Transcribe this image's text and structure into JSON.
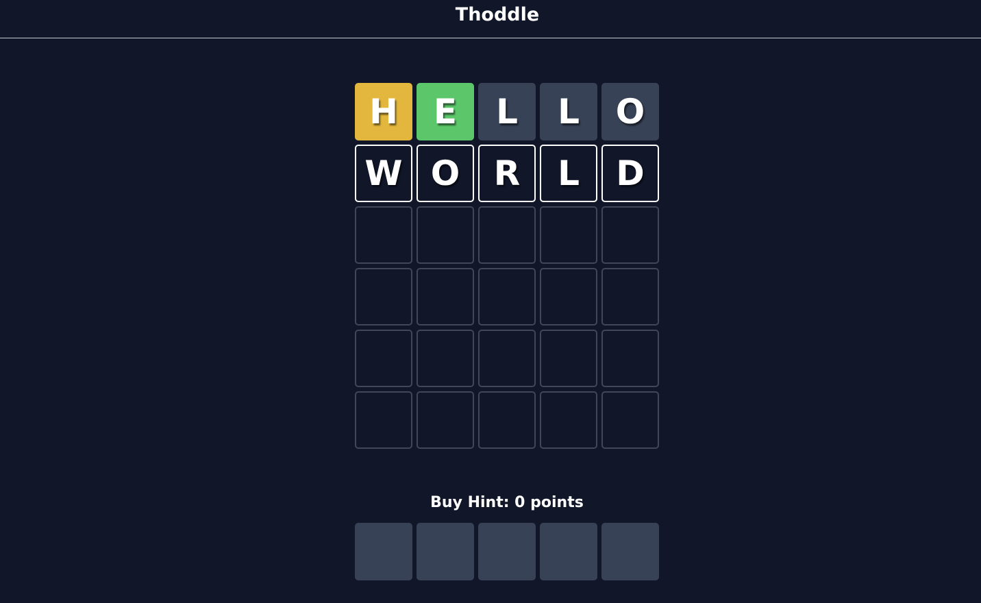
{
  "header": {
    "title": "Thoddle"
  },
  "board": {
    "rows": [
      [
        {
          "letter": "H",
          "state": "present"
        },
        {
          "letter": "E",
          "state": "correct"
        },
        {
          "letter": "L",
          "state": "absent"
        },
        {
          "letter": "L",
          "state": "absent"
        },
        {
          "letter": "O",
          "state": "absent"
        }
      ],
      [
        {
          "letter": "W",
          "state": "typed"
        },
        {
          "letter": "O",
          "state": "typed"
        },
        {
          "letter": "R",
          "state": "typed"
        },
        {
          "letter": "L",
          "state": "typed"
        },
        {
          "letter": "D",
          "state": "typed"
        }
      ],
      [
        {
          "letter": "",
          "state": "empty"
        },
        {
          "letter": "",
          "state": "empty"
        },
        {
          "letter": "",
          "state": "empty"
        },
        {
          "letter": "",
          "state": "empty"
        },
        {
          "letter": "",
          "state": "empty"
        }
      ],
      [
        {
          "letter": "",
          "state": "empty"
        },
        {
          "letter": "",
          "state": "empty"
        },
        {
          "letter": "",
          "state": "empty"
        },
        {
          "letter": "",
          "state": "empty"
        },
        {
          "letter": "",
          "state": "empty"
        }
      ],
      [
        {
          "letter": "",
          "state": "empty"
        },
        {
          "letter": "",
          "state": "empty"
        },
        {
          "letter": "",
          "state": "empty"
        },
        {
          "letter": "",
          "state": "empty"
        },
        {
          "letter": "",
          "state": "empty"
        }
      ],
      [
        {
          "letter": "",
          "state": "empty"
        },
        {
          "letter": "",
          "state": "empty"
        },
        {
          "letter": "",
          "state": "empty"
        },
        {
          "letter": "",
          "state": "empty"
        },
        {
          "letter": "",
          "state": "empty"
        }
      ]
    ]
  },
  "hint": {
    "label": "Buy Hint: 0 points",
    "slots": [
      "",
      "",
      "",
      "",
      ""
    ]
  },
  "colors": {
    "background": "#111729",
    "present": "#e3b73e",
    "correct": "#5cc66a",
    "absent": "#374256",
    "empty_border": "#3f4759",
    "typed_border": "#ffffff"
  }
}
